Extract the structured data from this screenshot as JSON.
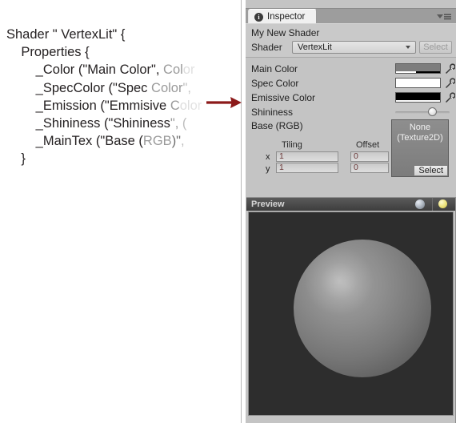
{
  "code": {
    "lines": [
      [
        {
          "t": "Shader \" VertexLit\" {",
          "fade": 0
        }
      ],
      [
        {
          "t": "    Properties {",
          "fade": 0
        }
      ],
      [
        {
          "t": "        _Color (\"Main Color\", ",
          "fade": 0
        },
        {
          "t": "Col",
          "fade": 2
        },
        {
          "t": "or",
          "fade": 4
        }
      ],
      [
        {
          "t": "        _SpecColor (\"Spec ",
          "fade": 0
        },
        {
          "t": "Color",
          "fade": 2
        },
        {
          "t": "\",",
          "fade": 3
        }
      ],
      [
        {
          "t": "        _Emission (\"Emmisive ",
          "fade": 0
        },
        {
          "t": "C",
          "fade": 2
        },
        {
          "t": "olor",
          "fade": 4
        }
      ],
      [
        {
          "t": "        _Shininess (\"Shininess",
          "fade": 0
        },
        {
          "t": "\",",
          "fade": 2
        },
        {
          "t": " (",
          "fade": 3
        }
      ],
      [
        {
          "t": "        _MainTex (\"Base (",
          "fade": 0
        },
        {
          "t": "RGB",
          "fade": 2
        },
        {
          "t": ")\"",
          "fade": 1
        },
        {
          "t": ",",
          "fade": 3
        }
      ],
      [
        {
          "t": "    }",
          "fade": 0
        }
      ]
    ]
  },
  "annotation": {
    "arrow_name": "right-arrow",
    "arrow_color": "#8c1a1a"
  },
  "inspector": {
    "tab_label": "Inspector",
    "tab_icon": "info-icon",
    "menu_icon": "options-menu-icon",
    "shader_name": "My New Shader",
    "shader_row_label": "Shader",
    "shader_dropdown_value": "VertexLit",
    "select_shader_label": "Select",
    "properties": [
      {
        "label": "Main Color",
        "type": "color",
        "color": "#7d7d7d",
        "alpha_fill": 45
      },
      {
        "label": "Spec Color",
        "type": "color",
        "color": "#ffffff",
        "alpha_fill": 100
      },
      {
        "label": "Emissive Color",
        "type": "color",
        "color": "#000000",
        "alpha_fill": 100
      },
      {
        "label": "Shininess",
        "type": "slider",
        "value": 0.6
      },
      {
        "label": "Base (RGB)",
        "type": "texture"
      }
    ],
    "texture": {
      "tiling_header": "Tiling",
      "offset_header": "Offset",
      "x_label": "x",
      "y_label": "y",
      "tiling_x": "1",
      "tiling_y": "1",
      "offset_x": "0",
      "offset_y": "0",
      "thumb_line1": "None",
      "thumb_line2": "(Texture2D)",
      "select_label": "Select"
    },
    "preview": {
      "label": "Preview",
      "sphere_icon": "sphere-preview-icon",
      "light_icon": "lighting-toggle-icon"
    }
  }
}
